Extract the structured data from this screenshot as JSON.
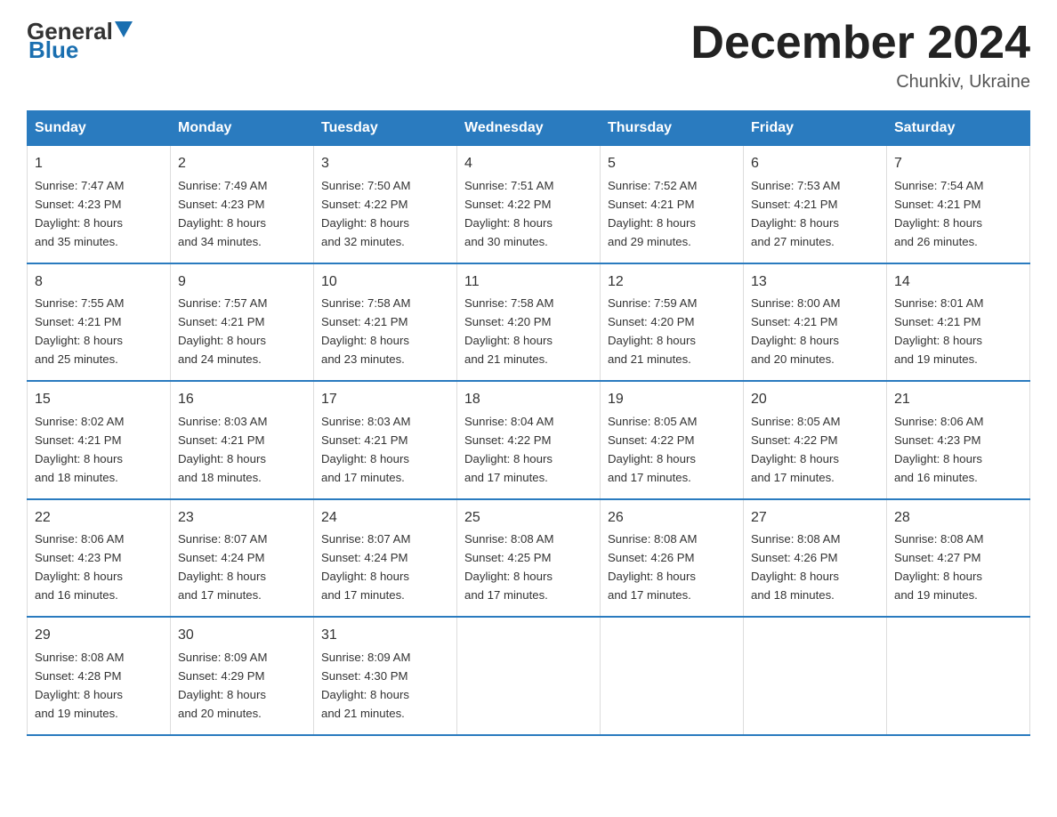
{
  "header": {
    "logo_general": "General",
    "logo_blue": "Blue",
    "month_title": "December 2024",
    "location": "Chunkiv, Ukraine"
  },
  "weekdays": [
    "Sunday",
    "Monday",
    "Tuesday",
    "Wednesday",
    "Thursday",
    "Friday",
    "Saturday"
  ],
  "weeks": [
    [
      {
        "day": "1",
        "sunrise": "7:47 AM",
        "sunset": "4:23 PM",
        "daylight": "8 hours and 35 minutes."
      },
      {
        "day": "2",
        "sunrise": "7:49 AM",
        "sunset": "4:23 PM",
        "daylight": "8 hours and 34 minutes."
      },
      {
        "day": "3",
        "sunrise": "7:50 AM",
        "sunset": "4:22 PM",
        "daylight": "8 hours and 32 minutes."
      },
      {
        "day": "4",
        "sunrise": "7:51 AM",
        "sunset": "4:22 PM",
        "daylight": "8 hours and 30 minutes."
      },
      {
        "day": "5",
        "sunrise": "7:52 AM",
        "sunset": "4:21 PM",
        "daylight": "8 hours and 29 minutes."
      },
      {
        "day": "6",
        "sunrise": "7:53 AM",
        "sunset": "4:21 PM",
        "daylight": "8 hours and 27 minutes."
      },
      {
        "day": "7",
        "sunrise": "7:54 AM",
        "sunset": "4:21 PM",
        "daylight": "8 hours and 26 minutes."
      }
    ],
    [
      {
        "day": "8",
        "sunrise": "7:55 AM",
        "sunset": "4:21 PM",
        "daylight": "8 hours and 25 minutes."
      },
      {
        "day": "9",
        "sunrise": "7:57 AM",
        "sunset": "4:21 PM",
        "daylight": "8 hours and 24 minutes."
      },
      {
        "day": "10",
        "sunrise": "7:58 AM",
        "sunset": "4:21 PM",
        "daylight": "8 hours and 23 minutes."
      },
      {
        "day": "11",
        "sunrise": "7:58 AM",
        "sunset": "4:20 PM",
        "daylight": "8 hours and 21 minutes."
      },
      {
        "day": "12",
        "sunrise": "7:59 AM",
        "sunset": "4:20 PM",
        "daylight": "8 hours and 21 minutes."
      },
      {
        "day": "13",
        "sunrise": "8:00 AM",
        "sunset": "4:21 PM",
        "daylight": "8 hours and 20 minutes."
      },
      {
        "day": "14",
        "sunrise": "8:01 AM",
        "sunset": "4:21 PM",
        "daylight": "8 hours and 19 minutes."
      }
    ],
    [
      {
        "day": "15",
        "sunrise": "8:02 AM",
        "sunset": "4:21 PM",
        "daylight": "8 hours and 18 minutes."
      },
      {
        "day": "16",
        "sunrise": "8:03 AM",
        "sunset": "4:21 PM",
        "daylight": "8 hours and 18 minutes."
      },
      {
        "day": "17",
        "sunrise": "8:03 AM",
        "sunset": "4:21 PM",
        "daylight": "8 hours and 17 minutes."
      },
      {
        "day": "18",
        "sunrise": "8:04 AM",
        "sunset": "4:22 PM",
        "daylight": "8 hours and 17 minutes."
      },
      {
        "day": "19",
        "sunrise": "8:05 AM",
        "sunset": "4:22 PM",
        "daylight": "8 hours and 17 minutes."
      },
      {
        "day": "20",
        "sunrise": "8:05 AM",
        "sunset": "4:22 PM",
        "daylight": "8 hours and 17 minutes."
      },
      {
        "day": "21",
        "sunrise": "8:06 AM",
        "sunset": "4:23 PM",
        "daylight": "8 hours and 16 minutes."
      }
    ],
    [
      {
        "day": "22",
        "sunrise": "8:06 AM",
        "sunset": "4:23 PM",
        "daylight": "8 hours and 16 minutes."
      },
      {
        "day": "23",
        "sunrise": "8:07 AM",
        "sunset": "4:24 PM",
        "daylight": "8 hours and 17 minutes."
      },
      {
        "day": "24",
        "sunrise": "8:07 AM",
        "sunset": "4:24 PM",
        "daylight": "8 hours and 17 minutes."
      },
      {
        "day": "25",
        "sunrise": "8:08 AM",
        "sunset": "4:25 PM",
        "daylight": "8 hours and 17 minutes."
      },
      {
        "day": "26",
        "sunrise": "8:08 AM",
        "sunset": "4:26 PM",
        "daylight": "8 hours and 17 minutes."
      },
      {
        "day": "27",
        "sunrise": "8:08 AM",
        "sunset": "4:26 PM",
        "daylight": "8 hours and 18 minutes."
      },
      {
        "day": "28",
        "sunrise": "8:08 AM",
        "sunset": "4:27 PM",
        "daylight": "8 hours and 19 minutes."
      }
    ],
    [
      {
        "day": "29",
        "sunrise": "8:08 AM",
        "sunset": "4:28 PM",
        "daylight": "8 hours and 19 minutes."
      },
      {
        "day": "30",
        "sunrise": "8:09 AM",
        "sunset": "4:29 PM",
        "daylight": "8 hours and 20 minutes."
      },
      {
        "day": "31",
        "sunrise": "8:09 AM",
        "sunset": "4:30 PM",
        "daylight": "8 hours and 21 minutes."
      },
      null,
      null,
      null,
      null
    ]
  ],
  "labels": {
    "sunrise": "Sunrise:",
    "sunset": "Sunset:",
    "daylight": "Daylight:"
  }
}
